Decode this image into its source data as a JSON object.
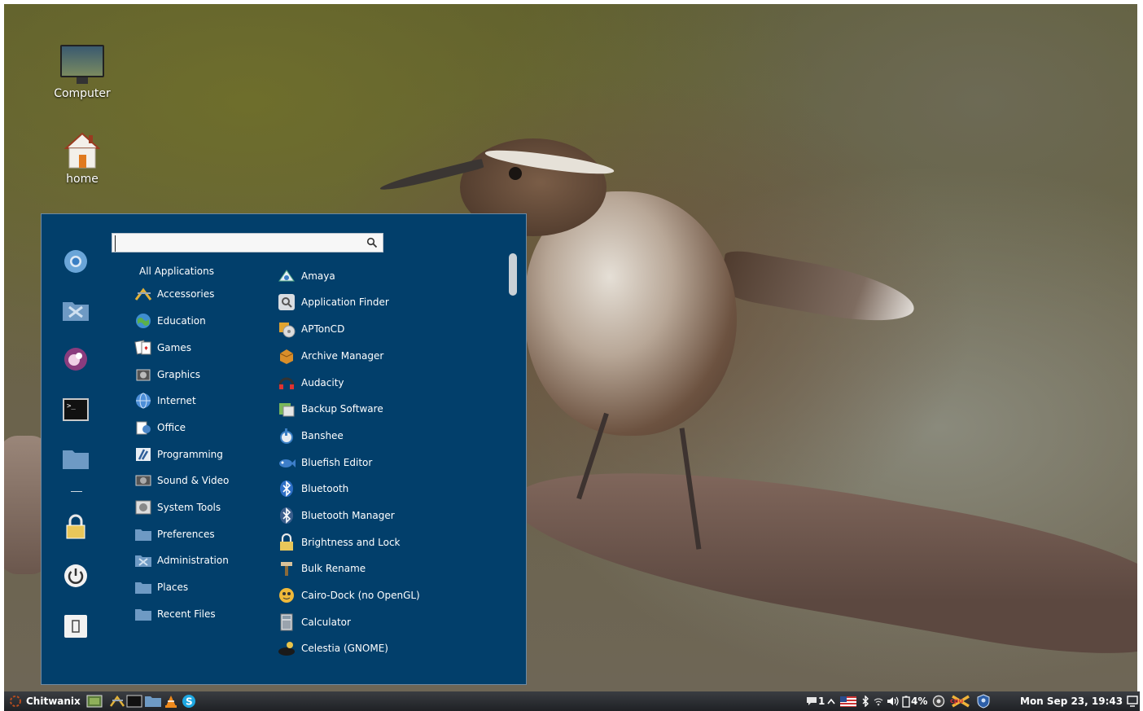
{
  "desktop": {
    "icons": [
      {
        "label": "Computer",
        "icon": "computer-icon"
      },
      {
        "label": "home",
        "icon": "home-folder-icon"
      }
    ]
  },
  "menu": {
    "search": {
      "value": "",
      "placeholder": ""
    },
    "favorites": [
      {
        "name": "chromium-icon"
      },
      {
        "name": "settings-manager-icon"
      },
      {
        "name": "emblem-icon"
      },
      {
        "name": "terminal-icon"
      },
      {
        "name": "folder-icon"
      },
      {
        "name": "lock-screen-icon"
      },
      {
        "name": "power-icon"
      },
      {
        "name": "logout-icon"
      }
    ],
    "categories": [
      {
        "label": "All Applications",
        "icon": ""
      },
      {
        "label": "Accessories",
        "icon": "accessories-icon"
      },
      {
        "label": "Education",
        "icon": "education-icon"
      },
      {
        "label": "Games",
        "icon": "games-icon"
      },
      {
        "label": "Graphics",
        "icon": "graphics-icon"
      },
      {
        "label": "Internet",
        "icon": "internet-icon"
      },
      {
        "label": "Office",
        "icon": "office-icon"
      },
      {
        "label": "Programming",
        "icon": "programming-icon"
      },
      {
        "label": "Sound & Video",
        "icon": "sound-video-icon"
      },
      {
        "label": "System Tools",
        "icon": "system-tools-icon"
      },
      {
        "label": "Preferences",
        "icon": "preferences-folder-icon"
      },
      {
        "label": "Administration",
        "icon": "administration-icon"
      },
      {
        "label": "Places",
        "icon": "places-folder-icon"
      },
      {
        "label": "Recent Files",
        "icon": "recent-files-folder-icon"
      }
    ],
    "apps": [
      {
        "label": "Amaya",
        "icon": "amaya-icon"
      },
      {
        "label": "Application Finder",
        "icon": "application-finder-icon"
      },
      {
        "label": "APTonCD",
        "icon": "aptoncd-icon"
      },
      {
        "label": "Archive Manager",
        "icon": "archive-manager-icon"
      },
      {
        "label": "Audacity",
        "icon": "audacity-icon"
      },
      {
        "label": "Backup Software",
        "icon": "backup-software-icon"
      },
      {
        "label": "Banshee",
        "icon": "banshee-icon"
      },
      {
        "label": "Bluefish Editor",
        "icon": "bluefish-icon"
      },
      {
        "label": "Bluetooth",
        "icon": "bluetooth-icon"
      },
      {
        "label": "Bluetooth Manager",
        "icon": "bluetooth-manager-icon"
      },
      {
        "label": "Brightness and Lock",
        "icon": "brightness-lock-icon"
      },
      {
        "label": "Bulk Rename",
        "icon": "bulk-rename-icon"
      },
      {
        "label": "Cairo-Dock (no OpenGL)",
        "icon": "cairo-dock-icon"
      },
      {
        "label": "Calculator",
        "icon": "calculator-icon"
      },
      {
        "label": "Celestia (GNOME)",
        "icon": "celestia-icon"
      }
    ]
  },
  "panel": {
    "menu_label": "Chitwanix",
    "workspace_count": "1",
    "battery": "4%",
    "clock": "Mon Sep 23, 19:43",
    "cpu_badge": "cpu",
    "colors": {
      "menu_bg": "#023f6b",
      "panel_bg": "#2a2c30"
    }
  }
}
